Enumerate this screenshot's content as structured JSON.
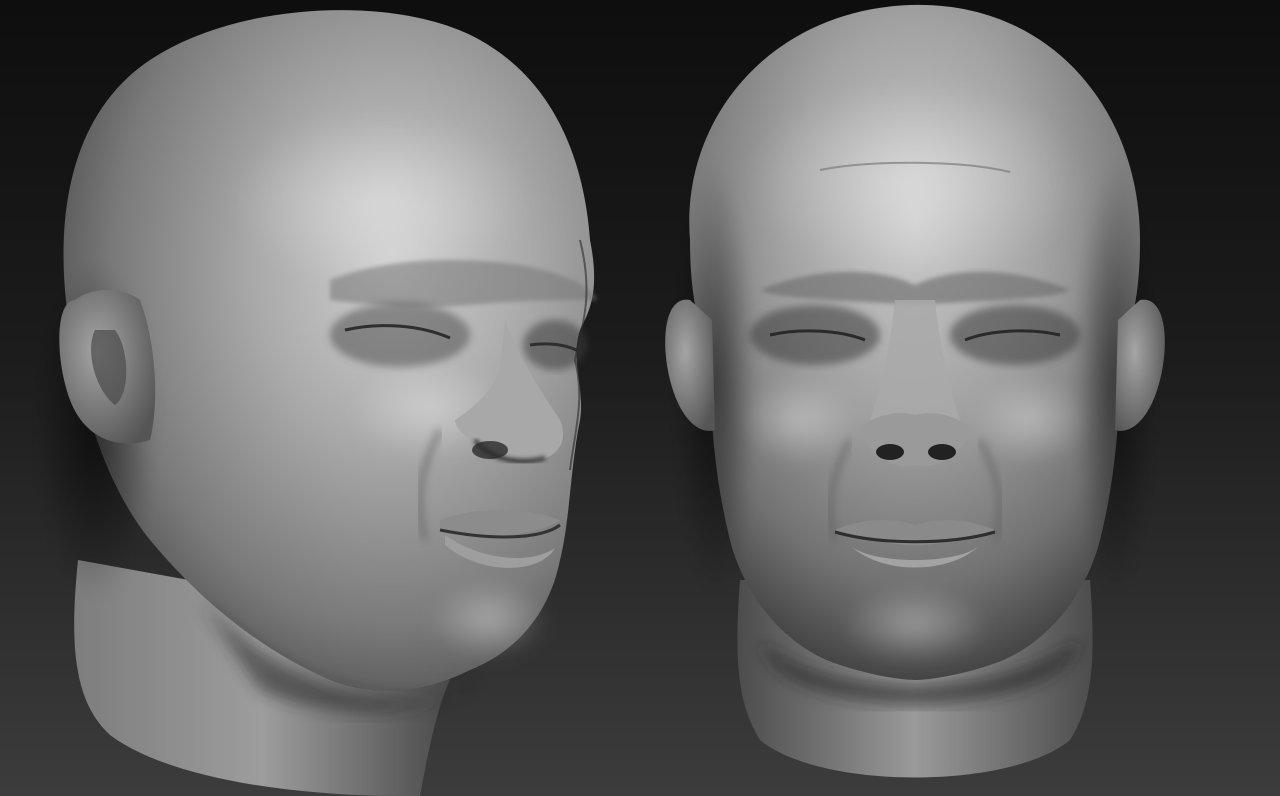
{
  "scene": {
    "subject": "two-sculpted-heads",
    "views": [
      "three-quarter-view",
      "front-view"
    ],
    "colors": {
      "background_top": "#0e0e0e",
      "background_bottom": "#3c3c3c",
      "skin_highlight": "#c9c9c9",
      "skin_mid": "#8f8f8f",
      "skin_shadow": "#3a3a3a"
    }
  }
}
